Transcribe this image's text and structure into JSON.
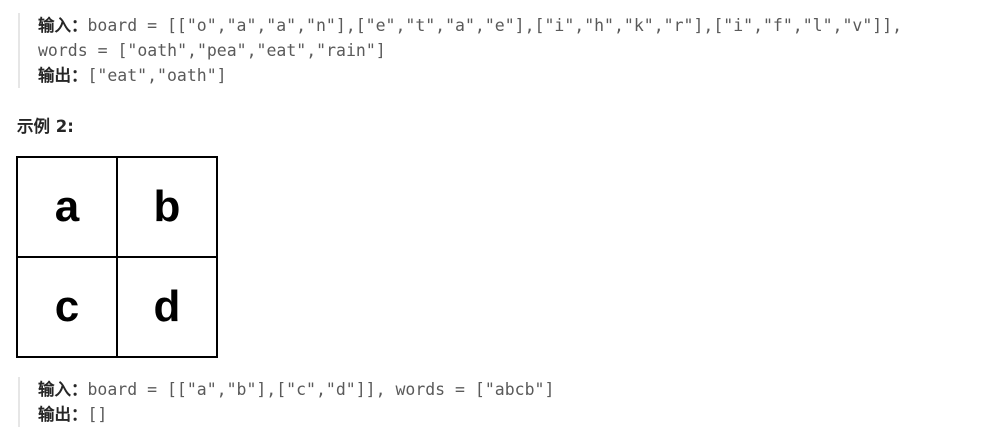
{
  "example1": {
    "input_label": "输入：",
    "input_line1": "board = [[\"o\",\"a\",\"a\",\"n\"],[\"e\",\"t\",\"a\",\"e\"],[\"i\",\"h\",\"k\",\"r\"],[\"i\",\"f\",\"l\",\"v\"]],",
    "input_line2": "words = [\"oath\",\"pea\",\"eat\",\"rain\"]",
    "output_label": "输出：",
    "output_value": "[\"eat\",\"oath\"]"
  },
  "example2": {
    "title": "示例 2:",
    "board": [
      [
        "a",
        "b"
      ],
      [
        "c",
        "d"
      ]
    ],
    "input_label": "输入：",
    "input_value": "board = [[\"a\",\"b\"],[\"c\",\"d\"]], words = [\"abcb\"]",
    "output_label": "输出：",
    "output_value": "[]"
  }
}
